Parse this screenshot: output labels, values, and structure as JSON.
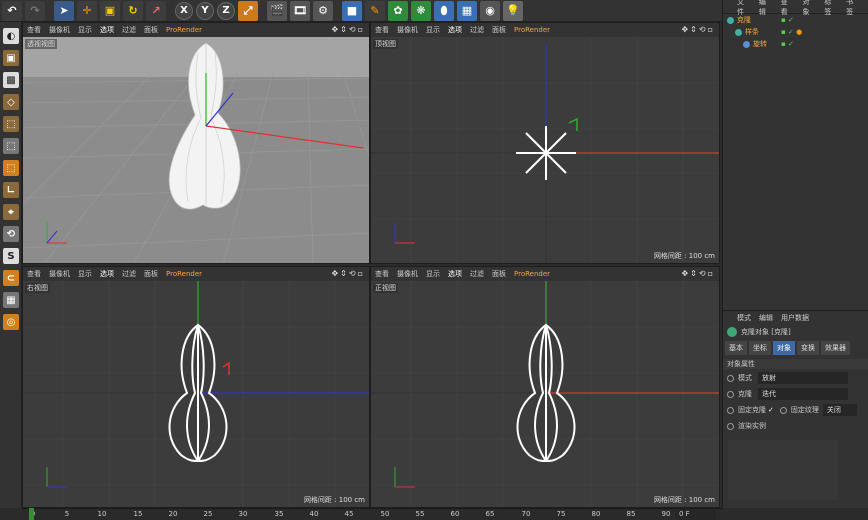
{
  "toolbar": {
    "undo_icon": "undo-icon",
    "axis_x": "X",
    "axis_y": "Y",
    "axis_z": "Z"
  },
  "viewport_menu": [
    "查看",
    "摄像机",
    "显示",
    "选项",
    "过滤",
    "面板",
    "ProRender"
  ],
  "viewports": {
    "perspective": {
      "label": "透视视图",
      "grid": ""
    },
    "top": {
      "label": "顶视图",
      "grid": "网格间距 : 100 cm"
    },
    "right": {
      "label": "右视图",
      "grid": "网格间距 : 100 cm"
    },
    "front": {
      "label": "正视图",
      "grid": "网格间距 : 100 cm"
    }
  },
  "object_manager": {
    "menu": [
      "文件",
      "编辑",
      "查看",
      "对象",
      "标签",
      "书签"
    ],
    "items": [
      {
        "name": "克隆",
        "depth": 0
      },
      {
        "name": "样条",
        "depth": 1
      },
      {
        "name": "旋转",
        "depth": 2
      }
    ]
  },
  "attribute_manager": {
    "menu": [
      "模式",
      "编辑",
      "用户数据"
    ],
    "title": "克隆对象 [克隆]",
    "tabs": [
      "基本",
      "坐标",
      "对象",
      "变换",
      "效果器"
    ],
    "active_tab": "对象",
    "section": "对象属性",
    "mode_label": "模式",
    "mode_value": "放射",
    "clone_label": "克隆",
    "clone_value": "迭代",
    "fixed_clone_label": "固定克隆",
    "fixed_clone_check": "✓",
    "fixed_texture_label": "固定纹理",
    "fixed_texture_value": "关闭",
    "render_instance_label": "渲染实例"
  },
  "timeline": {
    "ticks": [
      "0",
      "5",
      "10",
      "15",
      "20",
      "25",
      "30",
      "35",
      "40",
      "45",
      "50",
      "55",
      "60",
      "65",
      "70",
      "75",
      "80",
      "85",
      "90"
    ],
    "frame": "0 F"
  }
}
